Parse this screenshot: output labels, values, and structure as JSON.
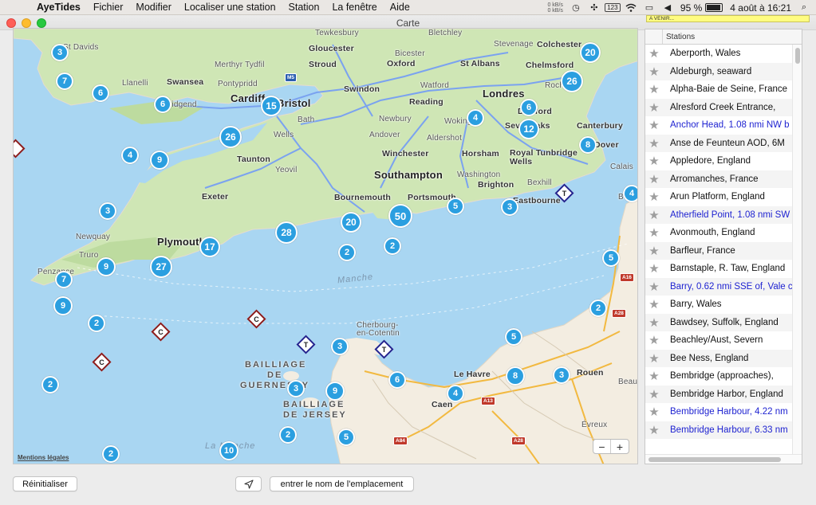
{
  "menubar": {
    "app": "AyeTides",
    "items": [
      "Fichier",
      "Modifier",
      "Localiser une station",
      "Station",
      "La fenêtre",
      "Aide"
    ],
    "net_up": "0 kB/s",
    "net_down": "0 kB/s",
    "keyboard": "123",
    "battery": "95 %",
    "battery_level": 0.95,
    "datetime": "4 août à 16:21"
  },
  "window": {
    "title": "Carte",
    "notification": "A VENIR..."
  },
  "map": {
    "places": [
      {
        "text": "St Davids"
      },
      {
        "text": "Llanelli"
      },
      {
        "text": "Swansea"
      },
      {
        "text": "Merthyr Tydfil"
      },
      {
        "text": "Pontypridd"
      },
      {
        "text": "Bridgend"
      },
      {
        "text": "Cardiff"
      },
      {
        "text": "Tewkesbury"
      },
      {
        "text": "Gloucester"
      },
      {
        "text": "Stroud"
      },
      {
        "text": "Bristol"
      },
      {
        "text": "Bath"
      },
      {
        "text": "Wells"
      },
      {
        "text": "Swindon"
      },
      {
        "text": "Oxford"
      },
      {
        "text": "Bicester"
      },
      {
        "text": "Bletchley"
      },
      {
        "text": "Stevenage"
      },
      {
        "text": "St Albans"
      },
      {
        "text": "Colchester"
      },
      {
        "text": "Chelmsford"
      },
      {
        "text": "Watford"
      },
      {
        "text": "Londres"
      },
      {
        "text": "Rochford"
      },
      {
        "text": "Reading"
      },
      {
        "text": "Newbury"
      },
      {
        "text": "Woking"
      },
      {
        "text": "Dartford"
      },
      {
        "text": "Sevenoaks"
      },
      {
        "text": "Canterbury"
      },
      {
        "text": "Dover"
      },
      {
        "text": "Andover"
      },
      {
        "text": "Aldershot"
      },
      {
        "text": "Winchester"
      },
      {
        "text": "Horsham"
      },
      {
        "text": "Royal Tunbridge Wells"
      },
      {
        "text": "Southampton"
      },
      {
        "text": "Washington"
      },
      {
        "text": "Brighton"
      },
      {
        "text": "Bexhill"
      },
      {
        "text": "Eastbourne"
      },
      {
        "text": "Bournemouth"
      },
      {
        "text": "Portsmouth"
      },
      {
        "text": "Taunton"
      },
      {
        "text": "Yeovil"
      },
      {
        "text": "Exeter"
      },
      {
        "text": "Plymouth"
      },
      {
        "text": "Newquay"
      },
      {
        "text": "Truro"
      },
      {
        "text": "Penzance"
      },
      {
        "text": "Calais"
      },
      {
        "text": "Boulo"
      },
      {
        "text": "Cherbourg-en-Cotentin"
      },
      {
        "text": "Le Havre"
      },
      {
        "text": "Rouen"
      },
      {
        "text": "Caen"
      },
      {
        "text": "Évreux"
      },
      {
        "text": "Beau"
      }
    ],
    "sea_labels": [
      "Manche",
      "La Manche"
    ],
    "islands": [
      "BAILLIAGE",
      "DE",
      "GUERNESEY",
      "BAILLIAGE",
      "DE JERSEY"
    ],
    "road_signs": [
      "M5",
      "A16",
      "A28",
      "A13",
      "A84",
      "A28"
    ],
    "clusters": [
      "3",
      "7",
      "6",
      "6",
      "15",
      "26",
      "4",
      "9",
      "3",
      "28",
      "17",
      "9",
      "27",
      "7",
      "9",
      "2",
      "20",
      "50",
      "2",
      "5",
      "3",
      "4",
      "12",
      "6",
      "26",
      "20",
      "8",
      "4",
      "5",
      "2",
      "5",
      "3",
      "6",
      "8",
      "3",
      "4",
      "9",
      "3",
      "2",
      "5",
      "2",
      "10"
    ],
    "markers": [
      {
        "kind": "current",
        "letter": "C"
      },
      {
        "kind": "current",
        "letter": "C"
      },
      {
        "kind": "current",
        "letter": "C"
      },
      {
        "kind": "tide",
        "letter": "T"
      },
      {
        "kind": "tide",
        "letter": "T"
      },
      {
        "kind": "tide",
        "letter": "T"
      },
      {
        "kind": "current",
        "letter": ""
      }
    ],
    "legal_text": "Mentions légales",
    "zoom_out": "−",
    "zoom_in": "+"
  },
  "stations": {
    "header": "Stations",
    "rows": [
      {
        "name": "Aberporth, Wales",
        "link": false
      },
      {
        "name": "Aldeburgh, seaward",
        "link": false
      },
      {
        "name": "Alpha-Baie de Seine, France",
        "link": false
      },
      {
        "name": "Alresford Creek Entrance,",
        "link": false
      },
      {
        "name": "Anchor Head, 1.08 nmi NW b",
        "link": true
      },
      {
        "name": "Anse de Feunteun AOD, 6M",
        "link": false
      },
      {
        "name": "Appledore, England",
        "link": false
      },
      {
        "name": "Arromanches, France",
        "link": false
      },
      {
        "name": "Arun Platform, England",
        "link": false
      },
      {
        "name": "Atherfield Point, 1.08 nmi SW",
        "link": true
      },
      {
        "name": "Avonmouth, England",
        "link": false
      },
      {
        "name": "Barfleur, France",
        "link": false
      },
      {
        "name": "Barnstaple, R. Taw, England",
        "link": false
      },
      {
        "name": "Barry, 0.62 nmi SSE of, Vale c",
        "link": true
      },
      {
        "name": "Barry, Wales",
        "link": false
      },
      {
        "name": "Bawdsey, Suffolk, England",
        "link": false
      },
      {
        "name": "Beachley/Aust, Severn",
        "link": false
      },
      {
        "name": "Bee Ness, England",
        "link": false
      },
      {
        "name": "Bembridge (approaches),",
        "link": false
      },
      {
        "name": "Bembridge Harbor, England",
        "link": false
      },
      {
        "name": "Bembridge Harbour, 4.22 nm",
        "link": true
      },
      {
        "name": "Bembridge Harbour, 6.33 nm",
        "link": true
      }
    ]
  },
  "buttons": {
    "reset": "Réinitialiser",
    "search": "entrer le nom de l'emplacement"
  }
}
